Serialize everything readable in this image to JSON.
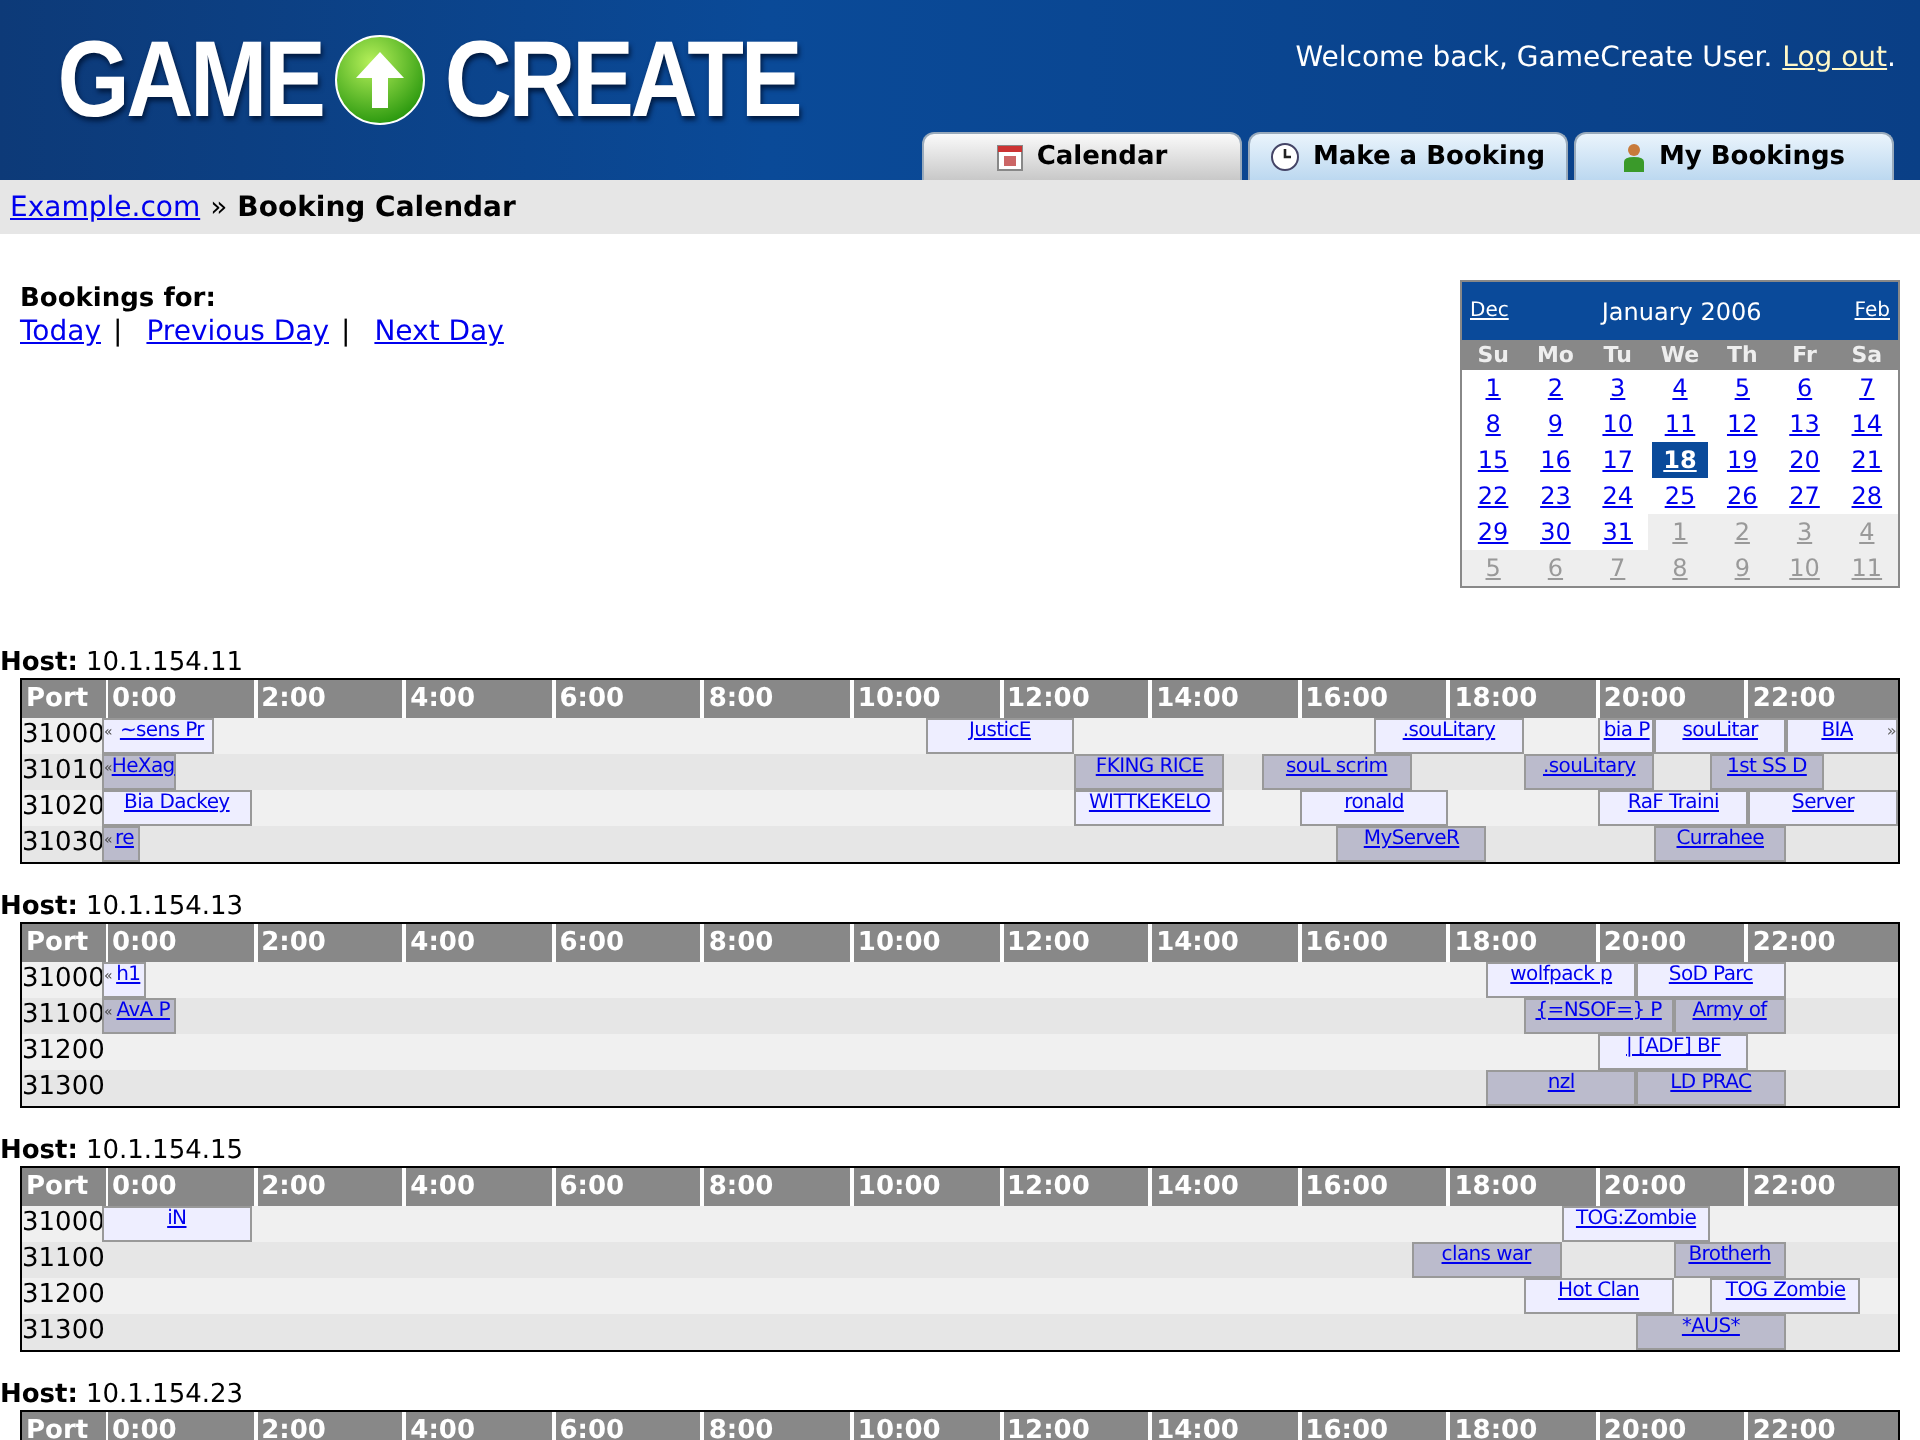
{
  "header": {
    "logo_left": "GAME",
    "logo_right": "CREATE",
    "welcome": "Welcome back, GameCreate User.",
    "logout": "Log out",
    "after_logout": "."
  },
  "tabs": [
    {
      "label": "Calendar",
      "selected": true
    },
    {
      "label": "Make a Booking",
      "selected": false
    },
    {
      "label": "My Bookings",
      "selected": false
    }
  ],
  "breadcrumb": {
    "link": "Example.com",
    "separator": "»",
    "current": "Booking Calendar"
  },
  "bookings_for": {
    "title": "Bookings for:",
    "links": [
      "Today",
      "Previous Day",
      "Next Day"
    ],
    "separator": "|"
  },
  "calendar": {
    "prev": "Dec",
    "title": "January 2006",
    "next": "Feb",
    "weekdays": [
      "Su",
      "Mo",
      "Tu",
      "We",
      "Th",
      "Fr",
      "Sa"
    ],
    "weeks": [
      [
        {
          "day": "1",
          "other_month": false,
          "selected": false
        },
        {
          "day": "2",
          "other_month": false,
          "selected": false
        },
        {
          "day": "3",
          "other_month": false,
          "selected": false
        },
        {
          "day": "4",
          "other_month": false,
          "selected": false
        },
        {
          "day": "5",
          "other_month": false,
          "selected": false
        },
        {
          "day": "6",
          "other_month": false,
          "selected": false
        },
        {
          "day": "7",
          "other_month": false,
          "selected": false
        }
      ],
      [
        {
          "day": "8",
          "other_month": false,
          "selected": false
        },
        {
          "day": "9",
          "other_month": false,
          "selected": false
        },
        {
          "day": "10",
          "other_month": false,
          "selected": false
        },
        {
          "day": "11",
          "other_month": false,
          "selected": false
        },
        {
          "day": "12",
          "other_month": false,
          "selected": false
        },
        {
          "day": "13",
          "other_month": false,
          "selected": false
        },
        {
          "day": "14",
          "other_month": false,
          "selected": false
        }
      ],
      [
        {
          "day": "15",
          "other_month": false,
          "selected": false
        },
        {
          "day": "16",
          "other_month": false,
          "selected": false
        },
        {
          "day": "17",
          "other_month": false,
          "selected": false
        },
        {
          "day": "18",
          "other_month": false,
          "selected": true
        },
        {
          "day": "19",
          "other_month": false,
          "selected": false
        },
        {
          "day": "20",
          "other_month": false,
          "selected": false
        },
        {
          "day": "21",
          "other_month": false,
          "selected": false
        }
      ],
      [
        {
          "day": "22",
          "other_month": false,
          "selected": false
        },
        {
          "day": "23",
          "other_month": false,
          "selected": false
        },
        {
          "day": "24",
          "other_month": false,
          "selected": false
        },
        {
          "day": "25",
          "other_month": false,
          "selected": false
        },
        {
          "day": "26",
          "other_month": false,
          "selected": false
        },
        {
          "day": "27",
          "other_month": false,
          "selected": false
        },
        {
          "day": "28",
          "other_month": false,
          "selected": false
        }
      ],
      [
        {
          "day": "29",
          "other_month": false,
          "selected": false
        },
        {
          "day": "30",
          "other_month": false,
          "selected": false
        },
        {
          "day": "31",
          "other_month": false,
          "selected": false
        },
        {
          "day": "1",
          "other_month": true,
          "selected": false
        },
        {
          "day": "2",
          "other_month": true,
          "selected": false
        },
        {
          "day": "3",
          "other_month": true,
          "selected": false
        },
        {
          "day": "4",
          "other_month": true,
          "selected": false
        }
      ],
      [
        {
          "day": "5",
          "other_month": true,
          "selected": false
        },
        {
          "day": "6",
          "other_month": true,
          "selected": false
        },
        {
          "day": "7",
          "other_month": true,
          "selected": false
        },
        {
          "day": "8",
          "other_month": true,
          "selected": false
        },
        {
          "day": "9",
          "other_month": true,
          "selected": false
        },
        {
          "day": "10",
          "other_month": true,
          "selected": false
        },
        {
          "day": "11",
          "other_month": true,
          "selected": false
        }
      ]
    ]
  },
  "hosts": [
    {
      "label": "Host:",
      "address": "10.1.154.11",
      "port_heading": "Port",
      "hours": [
        "0:00",
        "2:00",
        "4:00",
        "6:00",
        "8:00",
        "10:00",
        "12:00",
        "14:00",
        "16:00",
        "18:00",
        "20:00",
        "22:00"
      ],
      "ports": [
        {
          "port": "31000",
          "bookings": [
            {
              "name": "~sens Pr",
              "shaded": false,
              "before": "«"
            },
            {
              "name": "JusticE",
              "shaded": false
            },
            {
              "name": ".souLitary",
              "shaded": false
            },
            {
              "name": "bia P",
              "shaded": false
            },
            {
              "name": "souLitar",
              "shaded": false
            },
            {
              "name": "BIA",
              "shaded": false,
              "after": "»"
            }
          ]
        },
        {
          "port": "31010",
          "bookings": [
            {
              "name": "HeXag",
              "shaded": true,
              "before": "«"
            },
            {
              "name": "FKING RICE",
              "shaded": true
            },
            {
              "name": "souL scrim",
              "shaded": true
            },
            {
              "name": ".souLitary",
              "shaded": true
            },
            {
              "name": "1st SS D",
              "shaded": true
            }
          ]
        },
        {
          "port": "31020",
          "bookings": [
            {
              "name": "Bia Dackey",
              "shaded": false
            },
            {
              "name": "WITTKEKELO",
              "shaded": false
            },
            {
              "name": "ronald",
              "shaded": false
            },
            {
              "name": "RaF Traini",
              "shaded": false
            },
            {
              "name": "Server",
              "shaded": false
            }
          ]
        },
        {
          "port": "31030",
          "bookings": [
            {
              "name": "re",
              "shaded": true,
              "before": "«"
            },
            {
              "name": "MyServeR",
              "shaded": true
            },
            {
              "name": "Currahee",
              "shaded": true
            }
          ]
        }
      ]
    },
    {
      "label": "Host:",
      "address": "10.1.154.13",
      "port_heading": "Port",
      "hours": [
        "0:00",
        "2:00",
        "4:00",
        "6:00",
        "8:00",
        "10:00",
        "12:00",
        "14:00",
        "16:00",
        "18:00",
        "20:00",
        "22:00"
      ],
      "ports": [
        {
          "port": "31000",
          "bookings": [
            {
              "name": "h1",
              "shaded": false,
              "before": "«"
            },
            {
              "name": "wolfpack p",
              "shaded": false
            },
            {
              "name": "SoD Parc",
              "shaded": false
            }
          ]
        },
        {
          "port": "31100",
          "bookings": [
            {
              "name": "AvA P",
              "shaded": true,
              "before": "«"
            },
            {
              "name": "{=NSOF=} P",
              "shaded": true
            },
            {
              "name": "Army of",
              "shaded": true
            }
          ]
        },
        {
          "port": "31200",
          "bookings": [
            {
              "name": "| [ADF] BF",
              "shaded": false
            }
          ]
        },
        {
          "port": "31300",
          "bookings": [
            {
              "name": "nzl",
              "shaded": true
            },
            {
              "name": "LD PRAC",
              "shaded": true
            }
          ]
        }
      ]
    },
    {
      "label": "Host:",
      "address": "10.1.154.15",
      "port_heading": "Port",
      "hours": [
        "0:00",
        "2:00",
        "4:00",
        "6:00",
        "8:00",
        "10:00",
        "12:00",
        "14:00",
        "16:00",
        "18:00",
        "20:00",
        "22:00"
      ],
      "ports": [
        {
          "port": "31000",
          "bookings": [
            {
              "name": "iN",
              "shaded": false
            },
            {
              "name": "TOG:Zombie",
              "shaded": false
            }
          ]
        },
        {
          "port": "31100",
          "bookings": [
            {
              "name": "clans war",
              "shaded": true
            },
            {
              "name": "Brotherh",
              "shaded": true
            }
          ]
        },
        {
          "port": "31200",
          "bookings": [
            {
              "name": "Hot Clan",
              "shaded": false
            },
            {
              "name": "TOG Zombie",
              "shaded": false
            }
          ]
        },
        {
          "port": "31300",
          "bookings": [
            {
              "name": "*AUS*",
              "shaded": true
            }
          ]
        }
      ]
    },
    {
      "label": "Host:",
      "address": "10.1.154.23",
      "port_heading": "Port",
      "hours": [
        "0:00",
        "2:00",
        "4:00",
        "6:00",
        "8:00",
        "10:00",
        "12:00",
        "14:00",
        "16:00",
        "18:00",
        "20:00",
        "22:00"
      ]
    }
  ]
}
